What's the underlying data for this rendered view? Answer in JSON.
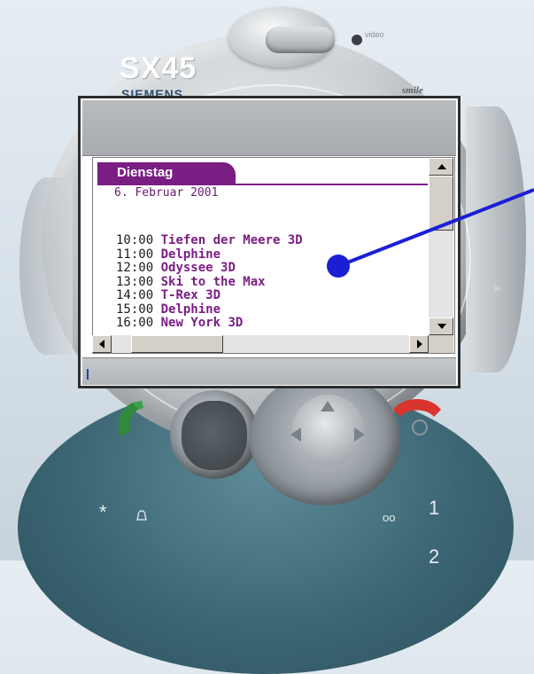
{
  "phone": {
    "model": "SX45",
    "brand": "SIEMENS",
    "top_label": "video",
    "sub_label": "smile"
  },
  "calendar": {
    "day": "Dienstag",
    "date": "6. Februar 2001",
    "schedule": [
      {
        "time": "10:00",
        "title": "Tiefen der Meere 3D"
      },
      {
        "time": "11:00",
        "title": "Delphine"
      },
      {
        "time": "12:00",
        "title": "Odyssee 3D"
      },
      {
        "time": "13:00",
        "title": "Ski to the Max"
      },
      {
        "time": "14:00",
        "title": "T-Rex 3D"
      },
      {
        "time": "15:00",
        "title": "Delphine"
      },
      {
        "time": "16:00",
        "title": "New York 3D"
      }
    ]
  },
  "keypad": {
    "star": "*",
    "one": "1",
    "two": "2",
    "voicemail": "oo"
  },
  "colors": {
    "accent": "#7a1e83",
    "annotation": "#1a1fd6",
    "call_green": "#2e8b3a",
    "end_red": "#d8352c"
  }
}
